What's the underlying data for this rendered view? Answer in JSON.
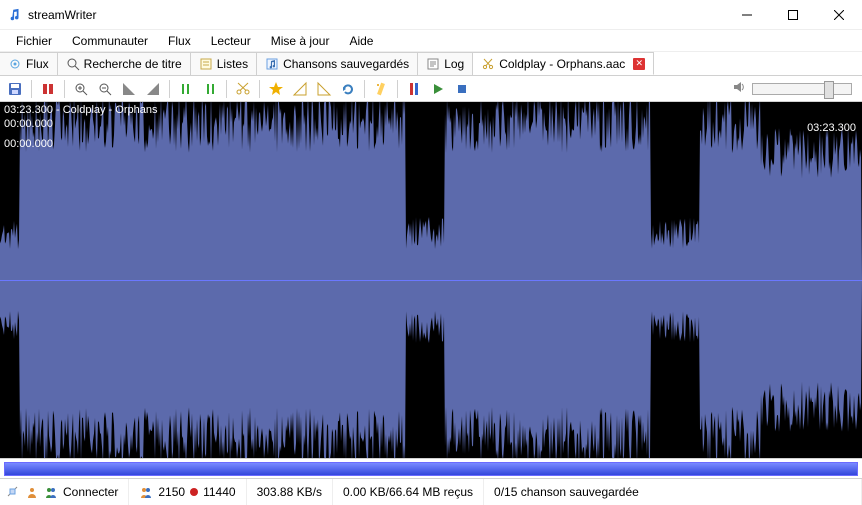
{
  "app": {
    "title": "streamWriter"
  },
  "menu": [
    "Fichier",
    "Communauter",
    "Flux",
    "Lecteur",
    "Mise à jour",
    "Aide"
  ],
  "tabs": [
    {
      "label": "Flux",
      "icon": "radio"
    },
    {
      "label": "Recherche de titre",
      "icon": "search"
    },
    {
      "label": "Listes",
      "icon": "list"
    },
    {
      "label": "Chansons sauvegardés",
      "icon": "music"
    },
    {
      "label": "Log",
      "icon": "log"
    },
    {
      "label": "Coldplay - Orphans.aac",
      "icon": "scissors",
      "closable": true,
      "active": true
    }
  ],
  "toolbar": {
    "buttons": [
      "save",
      "|",
      "undo",
      "|",
      "zoom-in",
      "zoom-out",
      "select-start",
      "select-end",
      "|",
      "prev",
      "next",
      "|",
      "cut",
      "|",
      "effects",
      "fade-in",
      "fade-out",
      "restore",
      "|",
      "auto-cut",
      "|",
      "marker",
      "play",
      "stop"
    ]
  },
  "wave": {
    "track_title": "03:23.300 - Coldplay - Orphans",
    "time_start_top": "00:00.000",
    "time_start_left": "00:00.000",
    "time_end": "03:23.300"
  },
  "status": {
    "connect": "Connecter",
    "listeners_green": "2150",
    "listeners_red": "11440",
    "bitrate": "303.88 KB/s",
    "received": "0.00 KB/66.64 MB reçus",
    "saved": "0/15 chanson sauvegardée"
  },
  "volume": {
    "position_pct": 72
  }
}
